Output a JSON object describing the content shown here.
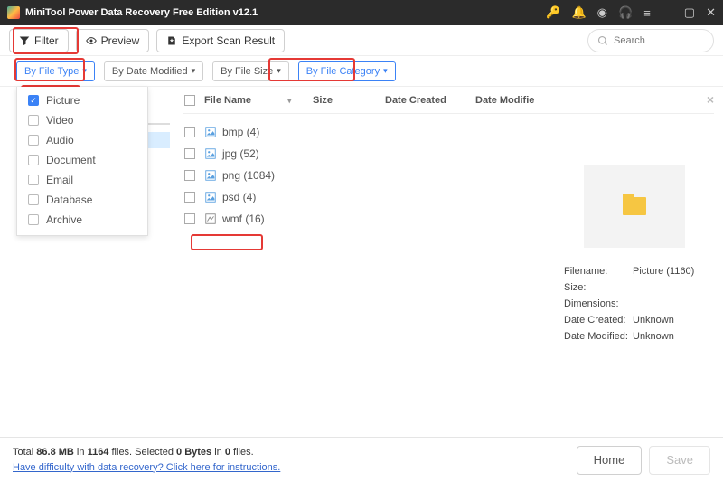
{
  "window": {
    "title": "MiniTool Power Data Recovery Free Edition v12.1"
  },
  "toolbar": {
    "filter": "Filter",
    "preview": "Preview",
    "export": "Export Scan Result",
    "search_placeholder": "Search"
  },
  "filter_row": {
    "by_type": "By File Type",
    "by_date": "By Date Modified",
    "by_size": "By File Size",
    "by_category": "By File Category"
  },
  "type_dropdown": {
    "items": [
      {
        "label": "Picture",
        "checked": true
      },
      {
        "label": "Video",
        "checked": false
      },
      {
        "label": "Audio",
        "checked": false
      },
      {
        "label": "Document",
        "checked": false
      },
      {
        "label": "Email",
        "checked": false
      },
      {
        "label": "Database",
        "checked": false
      },
      {
        "label": "Archive",
        "checked": false
      }
    ]
  },
  "columns": {
    "name": "File Name",
    "size": "Size",
    "created": "Date Created",
    "modified": "Date Modifie"
  },
  "files": [
    {
      "label": "bmp (4)"
    },
    {
      "label": "jpg (52)"
    },
    {
      "label": "png (1084)"
    },
    {
      "label": "psd (4)"
    },
    {
      "label": "wmf (16)"
    }
  ],
  "preview": {
    "filename_k": "Filename:",
    "filename_v": "Picture (1160)",
    "size_k": "Size:",
    "dim_k": "Dimensions:",
    "created_k": "Date Created:",
    "created_v": "Unknown",
    "modified_k": "Date Modified:",
    "modified_v": "Unknown"
  },
  "status": {
    "line1_a": "Total ",
    "line1_b": "86.8 MB",
    "line1_c": " in ",
    "line1_d": "1164",
    "line1_e": " files.   Selected ",
    "line1_f": "0 Bytes",
    "line1_g": " in ",
    "line1_h": "0",
    "line1_i": " files.",
    "help": "Have difficulty with data recovery? Click here for instructions.",
    "home": "Home",
    "save": "Save"
  }
}
